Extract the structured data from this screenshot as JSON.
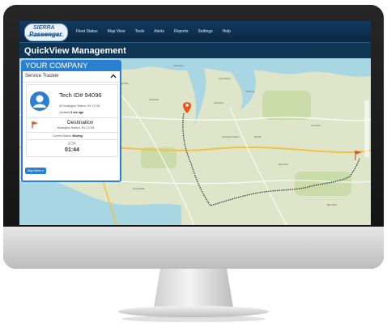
{
  "brand": {
    "line1": "SIERRA",
    "line2": "Passenger"
  },
  "nav": {
    "items": [
      "Fleet Status",
      "Map View",
      "Tools",
      "Alerts",
      "Reports",
      "Settings",
      "Help"
    ]
  },
  "page": {
    "title": "QuickView Management"
  },
  "panel": {
    "company": "YOUR COMPANY",
    "section_title": "Service Tracker",
    "tech_id": "Tech ID# 94096",
    "tech_address": "At Huntington Station, NY 11746",
    "updated_prefix": "Updated",
    "updated_value": "5 sec ago",
    "destination_label": "Destination",
    "destination_address": "Huntington Station, NY 11746",
    "status_prefix": "Current Status:",
    "status_value": "Moving",
    "eta_label": "ETA",
    "eta_value": "01:44",
    "map_menu_button": "Map Menu ▾"
  },
  "map": {
    "labels": [
      "Asharoken",
      "Centerport",
      "Huntington",
      "Northport",
      "Melville",
      "Farmingdale",
      "Deer Park",
      "Commack",
      "Bay Shore",
      "Oyster Bay",
      "Huntington Station",
      "Lloyd Harbor"
    ]
  },
  "icons": {
    "avatar": "user-avatar-icon",
    "flag": "destination-flag-icon",
    "collapse": "chevron-up-icon",
    "pin": "location-pin-icon"
  },
  "colors": {
    "nav_bg": "#0f3554",
    "accent": "#2a7fd1",
    "route": "#444444",
    "flag": "#e8541e"
  }
}
